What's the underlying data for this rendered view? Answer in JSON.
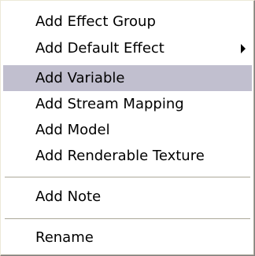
{
  "context_menu": {
    "items": [
      {
        "label": "Add Effect Group",
        "highlighted": false,
        "has_submenu": false
      },
      {
        "label": "Add Default Effect",
        "highlighted": false,
        "has_submenu": true,
        "submenu_icon": "triangle-right-icon"
      },
      {
        "label": "Add Variable",
        "highlighted": true,
        "has_submenu": false
      },
      {
        "label": "Add Stream Mapping",
        "highlighted": false,
        "has_submenu": false
      },
      {
        "label": "Add Model",
        "highlighted": false,
        "has_submenu": false
      },
      {
        "label": "Add Renderable Texture",
        "highlighted": false,
        "has_submenu": false
      },
      {
        "label": "Add Note",
        "highlighted": false,
        "has_submenu": false
      },
      {
        "label": "Rename",
        "highlighted": false,
        "has_submenu": false
      }
    ],
    "highlight_color": "#c1bfcf",
    "background_color": "#ffffff"
  }
}
